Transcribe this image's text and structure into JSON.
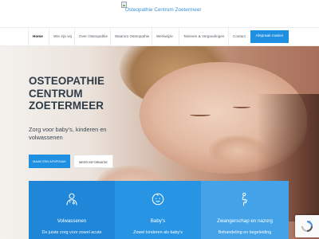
{
  "logo": {
    "alt_text": "Osteopathie Centrum Zoetermeer",
    "icon": "broken-image-icon"
  },
  "nav": {
    "items": [
      {
        "label": "Home",
        "active": true
      },
      {
        "label": "Wie zijn wij",
        "active": false
      },
      {
        "label": "Over Osteopathie",
        "active": false
      },
      {
        "label": "Waarom Osteopathie",
        "active": false
      },
      {
        "label": "Werkwijze",
        "active": false
      },
      {
        "label": "Tarieven & Vergoedingen",
        "active": false
      },
      {
        "label": "Contact",
        "active": false
      }
    ],
    "cta_label": "Afspraak maken"
  },
  "hero": {
    "title_lines": [
      "OSTEOPATHIE",
      "CENTRUM",
      "ZOETERMEER"
    ],
    "subtitle": "Zorg voor baby's, kinderen en volwassenen",
    "primary_button": "MAAK EEN AFSPRAAK",
    "secondary_button": "MEER INFORMATIE"
  },
  "cards": [
    {
      "title": "Volwassenen",
      "text": "De juiste zorg voor zowel acute",
      "icon": "doctor-icon",
      "color": "#1f86d8"
    },
    {
      "title": "Baby's",
      "text": "Zowel kinderen als baby's",
      "icon": "baby-icon",
      "color": "#2795e4"
    },
    {
      "title": "Zwangerschap en nazorg",
      "text": "Behandeling en begeleiding",
      "icon": "pregnancy-icon",
      "color": "#44a3e8"
    }
  ],
  "colors": {
    "accent": "#1e8fe1",
    "title_text": "#2f3b46"
  },
  "widgets": {
    "recaptcha_icon": "recaptcha-icon"
  }
}
